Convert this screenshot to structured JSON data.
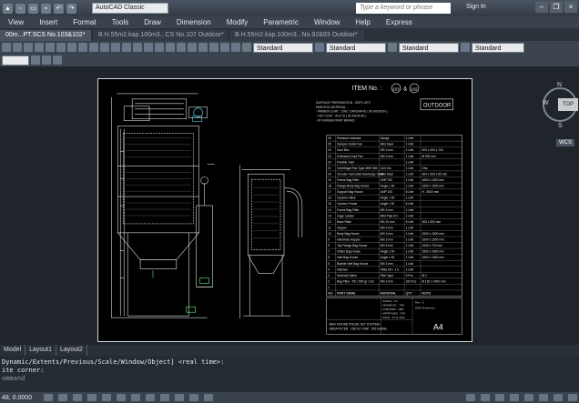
{
  "app": {
    "workspace": "AutoCAD Classic",
    "search_placeholder": "Type a keyword or phrase",
    "sign_in": "Sign In"
  },
  "menu": [
    "View",
    "Insert",
    "Format",
    "Tools",
    "Draw",
    "Dimension",
    "Modify",
    "Parametric",
    "Window",
    "Help",
    "Express"
  ],
  "doc_tabs": [
    {
      "label": "00m...PT.SCS No.103&102*",
      "active": true
    },
    {
      "label": "B.H.55m2.kap.100m3...CS No.107 Outdoor*",
      "active": false
    },
    {
      "label": "B.H.55m2.kap.100m3...No.92&93 Outdoor*",
      "active": false
    }
  ],
  "styles": {
    "text": "Standard",
    "dim": "Standard",
    "table": "Standard",
    "multileader": "Standard"
  },
  "drawing": {
    "item_label": "ITEM No. :",
    "item_a": "103",
    "item_amp": "&",
    "item_b": "102",
    "outdoor": "OUTDOOR",
    "notes": [
      "SURFACE PREPARATION : SSPC-SP3",
      "PAINTING MATERIAL :",
      "- PRIMER COAT : ZINC CHROMATE ( 80 MICRON )",
      "- TOP COAT : ALKYD ( 80 MICRON )",
      "- BY KANSAI PAINT BRAND"
    ],
    "bom": [
      [
        "26",
        "Pressure Indicator",
        "Gauge",
        "1 Unit",
        ""
      ],
      [
        "25",
        "Damper Outlet Fan",
        "Mild Steel",
        "1 Unit",
        ""
      ],
      [
        "24",
        "Duct Box",
        "MS 3 mm",
        "1 Unit",
        "400 x 400 x 700"
      ],
      [
        "23",
        "Extension Duct Fan",
        "MS 3 mm",
        "1 Unit",
        "Ø 300 mm"
      ],
      [
        "22",
        "Flexible Joint",
        "",
        "1 Unit",
        ""
      ],
      [
        "21",
        "Centrifugal Fan Type MKR 360 - 15,0 Kw",
        "",
        "1 Unit",
        "Ctrs"
      ],
      [
        "20",
        "Circular Horizontal Discharge Valve",
        "Mild Steel",
        "1 Unit",
        "300 x 300 x 80 mm"
      ],
      [
        "19",
        "Frame Bag Filter",
        "UNP 100",
        "1 Unit",
        "1500 x 1500 mm"
      ],
      [
        "18",
        "Flange Body Bag House",
        "Angle L 50",
        "1 Unit",
        "1500 x 1500 mm"
      ],
      [
        "17",
        "Support Bag House",
        "UNP 100",
        "6 Unit",
        "H : 3500 mm"
      ],
      [
        "16",
        "Cyclone Valve",
        "Angle L 50",
        "1 Unit",
        ""
      ],
      [
        "15",
        "Cyclone Frame",
        "Angle L 50",
        "6 Unit",
        ""
      ],
      [
        "14",
        "Frame Bag Filter",
        "MS 3 mm",
        "1 Unit",
        ""
      ],
      [
        "13",
        "Cage Ladder",
        "Mild Pipe Ø 1",
        "1 Unit",
        ""
      ],
      [
        "12",
        "Base Plate",
        "MS 10 mm",
        "6 Unit",
        "300 x 300 mm"
      ],
      [
        "11",
        "Hopper",
        "MS 3 mm",
        "1 Unit",
        ""
      ],
      [
        "10",
        "Body Bag House",
        "MS 3 mm",
        "1 Unit",
        "1500 x 1500 mm"
      ],
      [
        "9",
        "Handhole Hopper",
        "MS 3 mm",
        "1 Unit",
        "1500 x 1500 mm"
      ],
      [
        "8",
        "Top Flange Bag House",
        "MS 5 mm",
        "1 Unit",
        "1430 x 710 mm"
      ],
      [
        "7",
        "Outlet Bag House",
        "Angle L 50",
        "1 Unit",
        "1500 x 1500 mm"
      ],
      [
        "6",
        "Inlet Bag House",
        "Angle L 50",
        "1 Unit",
        "1500 x 1500 mm"
      ],
      [
        "5",
        "Bubble Inlet Bag House",
        "MS 3 mm",
        "1 Unit",
        ""
      ],
      [
        "4",
        "Hatches",
        "Plate Elf + 1.5",
        "1 Unit",
        ""
      ],
      [
        "3",
        "Solenoid Valve",
        "Pilot Type",
        "5 Pcs",
        "Ø 1\""
      ],
      [
        "2",
        "Bag Filter - PE / 500 gr / m2",
        "MS 3 mm",
        "100 Pcs",
        "Ø 150 x 2400 mm"
      ],
      [
        "1",
        "",
        "",
        "",
        ""
      ]
    ],
    "bom_header": [
      "NO",
      "PART NAME",
      "MATERIAL",
      "QTY",
      "NOTE"
    ],
    "tb_lines": [
      "SCALE : 1:5",
      "DRAWN BY : TKP",
      "CHECKED : JMR",
      "APPROVED : TKP",
      "DATE : 10.11.2011"
    ],
    "tb_company": "BAG HOUSE PULSE JET SYSTEM",
    "tb_title": "AREA FILTER : 108 m2 / KAP : 200 m3/min",
    "tb_sheet": "A4",
    "tb_rev": "Rev : 0",
    "tb_dwg": "DWG Reference"
  },
  "layout_tabs": [
    "Model",
    "Layout1",
    "Layout2"
  ],
  "command": {
    "line1": "Dynamic/Extents/Previous/Scale/Window/Object] <real time>:",
    "line2": "ite corner:",
    "prompt": "ommand"
  },
  "status": {
    "coord": "48, 0.0000"
  },
  "viewcube": {
    "top": "TOP",
    "n": "N",
    "w": "W",
    "s": "S",
    "wcs": "WCS"
  }
}
